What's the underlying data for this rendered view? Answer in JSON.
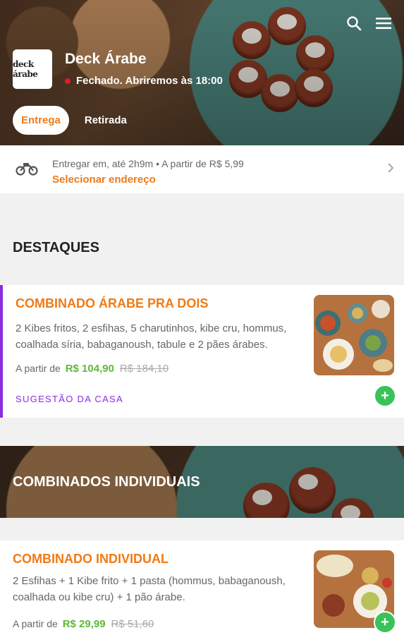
{
  "header": {
    "store_name": "Deck Árabe",
    "logo_text": "deck árabe",
    "status": "Fechado. Abriremos às 18:00",
    "status_color": "#e21b2b",
    "icons": [
      "search-icon",
      "menu-icon"
    ],
    "tabs": [
      {
        "label": "Entrega",
        "active": true
      },
      {
        "label": "Retirada",
        "active": false
      }
    ]
  },
  "delivery": {
    "info": "Entregar em, até 2h9m  •  A partir de R$ 5,99",
    "link": "Selecionar endereço",
    "icon": "motorcycle-icon"
  },
  "sections": {
    "highlights_title": "DESTAQUES",
    "individual_title": "COMBINADOS INDIVIDUAIS"
  },
  "products": [
    {
      "title": "COMBINADO ÁRABE PRA DOIS",
      "description": "2 Kibes fritos, 2 esfihas, 5 charutinhos, kibe cru, hommus, coalhada síria, babaganoush, tabule e 2 pães árabes.",
      "price_prefix": "A partir de",
      "price": "R$ 104,90",
      "old_price": "R$ 184,10",
      "tag": "SUGESTÃO DA CASA"
    },
    {
      "title": "COMBINADO INDIVIDUAL",
      "description": "2 Esfihas + 1 Kibe frito + 1 pasta (hommus, babaganoush, coalhada ou kibe cru) + 1 pão árabe.",
      "price_prefix": "A partir de",
      "price": "R$ 29,99",
      "old_price": "R$ 51,60"
    }
  ],
  "colors": {
    "accent": "#f07a15",
    "price": "#5fb936",
    "highlight": "#8a2be2",
    "add_button": "#39c25a"
  }
}
